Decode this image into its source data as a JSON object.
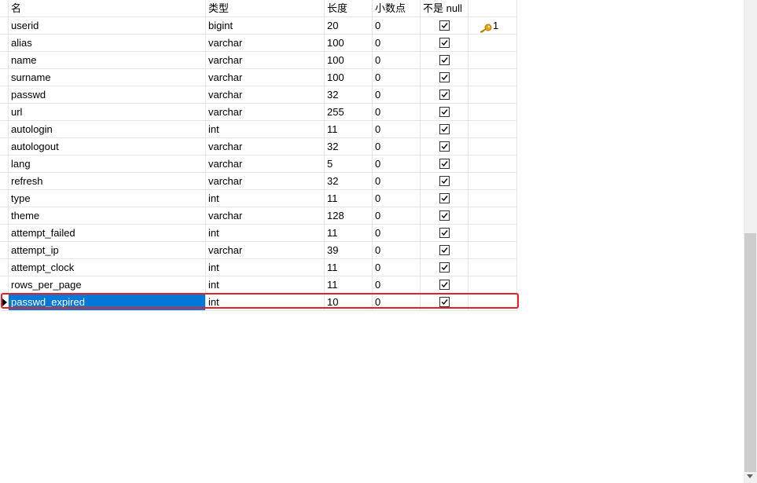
{
  "columns": {
    "name": "名",
    "type": "类型",
    "length": "长度",
    "decimals": "小数点",
    "not_null": "不是 null"
  },
  "rows": [
    {
      "name": "userid",
      "type": "bigint",
      "length": "20",
      "decimals": "0",
      "not_null": true,
      "key": "1"
    },
    {
      "name": "alias",
      "type": "varchar",
      "length": "100",
      "decimals": "0",
      "not_null": true
    },
    {
      "name": "name",
      "type": "varchar",
      "length": "100",
      "decimals": "0",
      "not_null": true
    },
    {
      "name": "surname",
      "type": "varchar",
      "length": "100",
      "decimals": "0",
      "not_null": true
    },
    {
      "name": "passwd",
      "type": "varchar",
      "length": "32",
      "decimals": "0",
      "not_null": true
    },
    {
      "name": "url",
      "type": "varchar",
      "length": "255",
      "decimals": "0",
      "not_null": true
    },
    {
      "name": "autologin",
      "type": "int",
      "length": "11",
      "decimals": "0",
      "not_null": true
    },
    {
      "name": "autologout",
      "type": "varchar",
      "length": "32",
      "decimals": "0",
      "not_null": true
    },
    {
      "name": "lang",
      "type": "varchar",
      "length": "5",
      "decimals": "0",
      "not_null": true
    },
    {
      "name": "refresh",
      "type": "varchar",
      "length": "32",
      "decimals": "0",
      "not_null": true
    },
    {
      "name": "type",
      "type": "int",
      "length": "11",
      "decimals": "0",
      "not_null": true
    },
    {
      "name": "theme",
      "type": "varchar",
      "length": "128",
      "decimals": "0",
      "not_null": true
    },
    {
      "name": "attempt_failed",
      "type": "int",
      "length": "11",
      "decimals": "0",
      "not_null": true
    },
    {
      "name": "attempt_ip",
      "type": "varchar",
      "length": "39",
      "decimals": "0",
      "not_null": true
    },
    {
      "name": "attempt_clock",
      "type": "int",
      "length": "11",
      "decimals": "0",
      "not_null": true
    },
    {
      "name": "rows_per_page",
      "type": "int",
      "length": "11",
      "decimals": "0",
      "not_null": true
    },
    {
      "name": "passwd_expired",
      "type": "int",
      "length": "10",
      "decimals": "0",
      "not_null": true
    }
  ],
  "selected_row": 16,
  "icons": {
    "primary_key": "key-icon",
    "row_indicator": "current-row-arrow-icon",
    "not_null": "checkbox-checked-icon"
  },
  "colors": {
    "selection": "#0078d7",
    "highlight_border": "#e0222a",
    "key": "#e6a817"
  }
}
